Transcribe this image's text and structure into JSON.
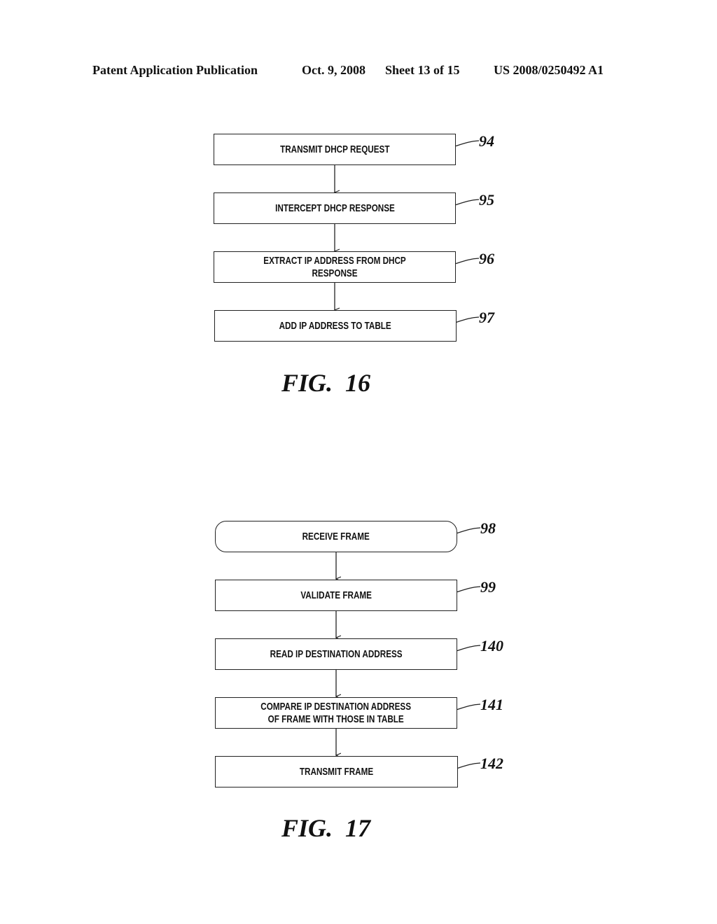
{
  "header": {
    "publication": "Patent Application Publication",
    "date": "Oct. 9, 2008",
    "sheet": "Sheet 13 of 15",
    "number": "US 2008/0250492 A1"
  },
  "fig16": {
    "caption": "FIG.  16",
    "steps": [
      {
        "label": "TRANSMIT DHCP REQUEST",
        "ref": "94"
      },
      {
        "label": "INTERCEPT DHCP RESPONSE",
        "ref": "95"
      },
      {
        "label": "EXTRACT IP ADDRESS FROM DHCP RESPONSE",
        "ref": "96"
      },
      {
        "label": "ADD IP ADDRESS TO TABLE",
        "ref": "97"
      }
    ]
  },
  "fig17": {
    "caption": "FIG.  17",
    "steps": [
      {
        "label": "RECEIVE FRAME",
        "ref": "98"
      },
      {
        "label": "VALIDATE FRAME",
        "ref": "99"
      },
      {
        "label": "READ IP DESTINATION ADDRESS",
        "ref": "140"
      },
      {
        "label": "COMPARE IP DESTINATION ADDRESS\nOF FRAME WITH THOSE IN TABLE",
        "ref": "141"
      },
      {
        "label": "TRANSMIT FRAME",
        "ref": "142"
      }
    ]
  }
}
